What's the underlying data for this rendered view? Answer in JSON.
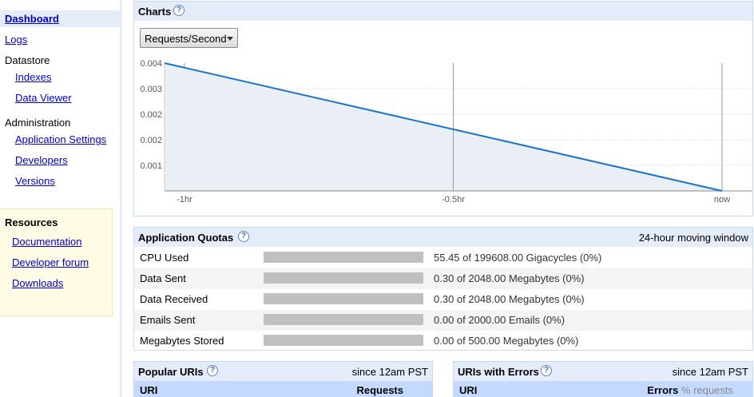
{
  "sidebar": {
    "items": [
      {
        "label": "Dashboard"
      },
      {
        "label": "Logs"
      },
      {
        "label": "Datastore"
      },
      {
        "label": "Indexes"
      },
      {
        "label": "Data Viewer"
      },
      {
        "label": "Administration"
      },
      {
        "label": "Application Settings"
      },
      {
        "label": "Developers"
      },
      {
        "label": "Versions"
      }
    ],
    "resources": {
      "title": "Resources",
      "links": [
        "Documentation",
        "Developer forum",
        "Downloads"
      ]
    }
  },
  "charts": {
    "title": "Charts",
    "help": "?",
    "selected_metric": "Requests/Second"
  },
  "chart_data": {
    "type": "area",
    "x_tick_labels": [
      "-1hr",
      "-0.5hr",
      "now"
    ],
    "y_tick_labels": [
      "0.004",
      "0.003",
      "0.002",
      "0.002",
      "0.001"
    ],
    "x": [
      -1.0,
      0.0
    ],
    "values": [
      0.004,
      0.0
    ],
    "ylim": [
      0,
      0.004
    ],
    "grid": true,
    "colors": {
      "line": "#1a75c9",
      "fill": "#e9eff5"
    }
  },
  "quotas": {
    "title": "Application Quotas",
    "help": "?",
    "window_label": "24-hour moving window",
    "rows": [
      {
        "name": "CPU Used",
        "value": "55.45 of 199608.00 Gigacycles (0%)",
        "fraction": 0
      },
      {
        "name": "Data Sent",
        "value": "0.30 of 2048.00 Megabytes (0%)",
        "fraction": 0
      },
      {
        "name": "Data Received",
        "value": "0.30 of 2048.00 Megabytes (0%)",
        "fraction": 0
      },
      {
        "name": "Emails Sent",
        "value": "0.00 of 2000.00 Emails (0%)",
        "fraction": 0
      },
      {
        "name": "Megabytes Stored",
        "value": "0.00 of 500.00 Megabytes (0%)",
        "fraction": 0
      }
    ]
  },
  "popular_uris": {
    "title": "Popular URIs",
    "help": "?",
    "since": "since 12am PST",
    "col_uri": "URI",
    "col_requests": "Requests"
  },
  "error_uris": {
    "title": "URIs with Errors",
    "help": "?",
    "since": "since 12am PST",
    "col_uri": "URI",
    "col_errors": "Errors",
    "col_pct": "% requests"
  }
}
